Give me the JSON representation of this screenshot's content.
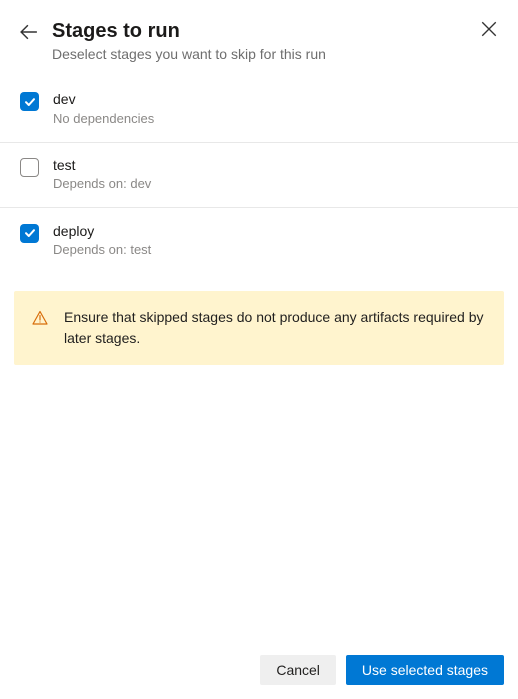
{
  "header": {
    "title": "Stages to run",
    "subtitle": "Deselect stages you want to skip for this run"
  },
  "stages": [
    {
      "name": "dev",
      "dependency": "No dependencies",
      "checked": true
    },
    {
      "name": "test",
      "dependency": "Depends on: dev",
      "checked": false
    },
    {
      "name": "deploy",
      "dependency": "Depends on: test",
      "checked": true
    }
  ],
  "warning": {
    "text": "Ensure that skipped stages do not produce any artifacts required by later stages."
  },
  "footer": {
    "cancel_label": "Cancel",
    "submit_label": "Use selected stages"
  },
  "colors": {
    "primary": "#0078d4",
    "warning_bg": "#fff4ce",
    "warning_icon": "#d86d0a"
  }
}
